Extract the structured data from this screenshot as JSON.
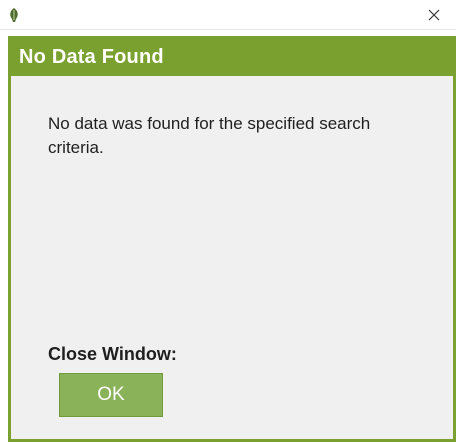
{
  "window": {
    "app_icon": "leaf-icon",
    "close_icon": "close-icon",
    "close_symbol": "×"
  },
  "dialog": {
    "title": "No Data Found",
    "message": "No data was found for the specified search criteria.",
    "close_label": "Close Window:",
    "ok_label": "OK"
  },
  "colors": {
    "accent": "#7aa12f",
    "button": "#8ab258",
    "panel_background": "#f0f0f0",
    "text": "#1f1f1f"
  }
}
